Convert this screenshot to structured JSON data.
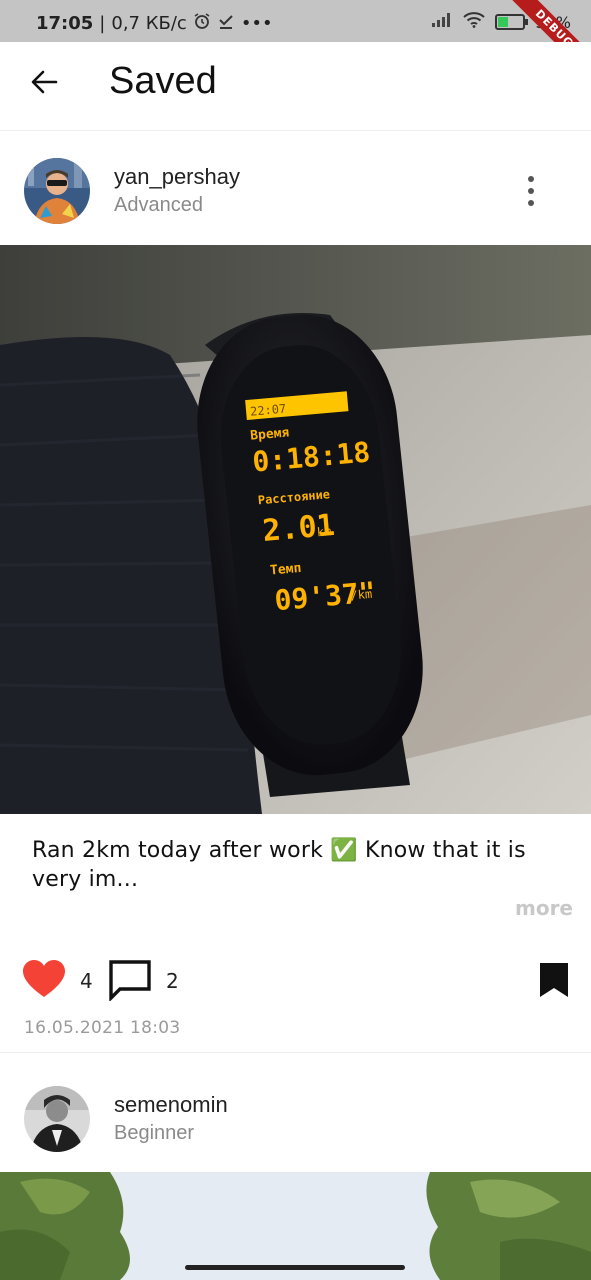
{
  "status_bar": {
    "time": "17:05",
    "speed": "0,7 КБ/с",
    "battery": "36%",
    "debug_label": "DEBUG"
  },
  "app_bar": {
    "title": "Saved",
    "back_icon": "arrow-left-icon"
  },
  "posts": [
    {
      "username": "yan_pershay",
      "level": "Advanced",
      "caption": "Ran 2km today after work ✅ Know that it is very im...",
      "more_label": "more",
      "likes": "4",
      "comments": "2",
      "date": "16.05.2021 18:03",
      "liked": true,
      "saved": true,
      "watch_screen": {
        "time_label": "Время",
        "time_value": "0:18:18",
        "distance_label": "Расстояние",
        "distance_value": "2.01",
        "distance_unit": "km",
        "pace_label": "Темп",
        "pace_value": "09'37\"",
        "pace_unit": "/km"
      }
    },
    {
      "username": "semenomin",
      "level": "Beginner"
    }
  ],
  "colors": {
    "like": "#f44336",
    "text": "#111111",
    "muted": "#9a9a9a",
    "status_bar": "#c4c4c4",
    "watch_text": "#ffb300"
  }
}
